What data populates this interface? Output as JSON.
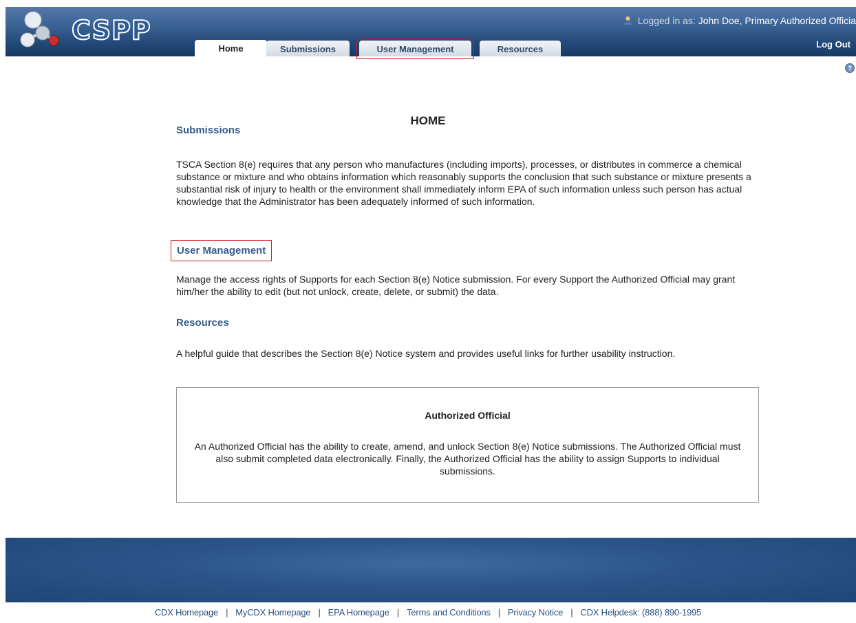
{
  "header": {
    "logo_text": "CSPP",
    "login_prefix": "Logged in as:",
    "login_user": "John Doe, Primary Authorized Officia",
    "logout_label": "Log Out"
  },
  "tabs": [
    {
      "label": "Home",
      "active": true
    },
    {
      "label": "Submissions"
    },
    {
      "label": "User Management",
      "highlighted": true
    },
    {
      "label": "Resources"
    }
  ],
  "page": {
    "title": "HOME"
  },
  "sections": {
    "submissions": {
      "heading": "Submissions",
      "text": "TSCA Section 8(e) requires that any person who manufactures (including imports), processes, or distributes in commerce a chemical substance or mixture and who obtains information which reasonably supports the conclusion that such substance or mixture presents a substantial risk of injury to health or the environment shall immediately inform EPA of such information unless such person has actual knowledge that the Administrator has been adequately informed of such information."
    },
    "user_management": {
      "heading": "User Management",
      "text": "Manage the access rights of Supports for each Section 8(e) Notice submission. For every Support the Authorized Official may grant him/her the ability to edit (but not unlock, create, delete, or submit) the data."
    },
    "resources": {
      "heading": "Resources",
      "text": "A helpful guide that describes the Section 8(e) Notice system and provides useful links for further usability instruction."
    }
  },
  "authorized_official": {
    "title": "Authorized Official",
    "text": "An Authorized Official has the ability to create, amend, and unlock Section 8(e) Notice submissions. The Authorized Official must also submit completed data electronically. Finally, the Authorized Official has the ability to assign Supports to individual submissions."
  },
  "footer": {
    "links": [
      "CDX Homepage",
      "MyCDX Homepage",
      "EPA Homepage",
      "Terms and Conditions",
      "Privacy Notice",
      "CDX Helpdesk: (888) 890-1995"
    ]
  },
  "colors": {
    "header_blue": "#224877",
    "heading_blue": "#365c8c",
    "highlight_red": "#d02020"
  }
}
